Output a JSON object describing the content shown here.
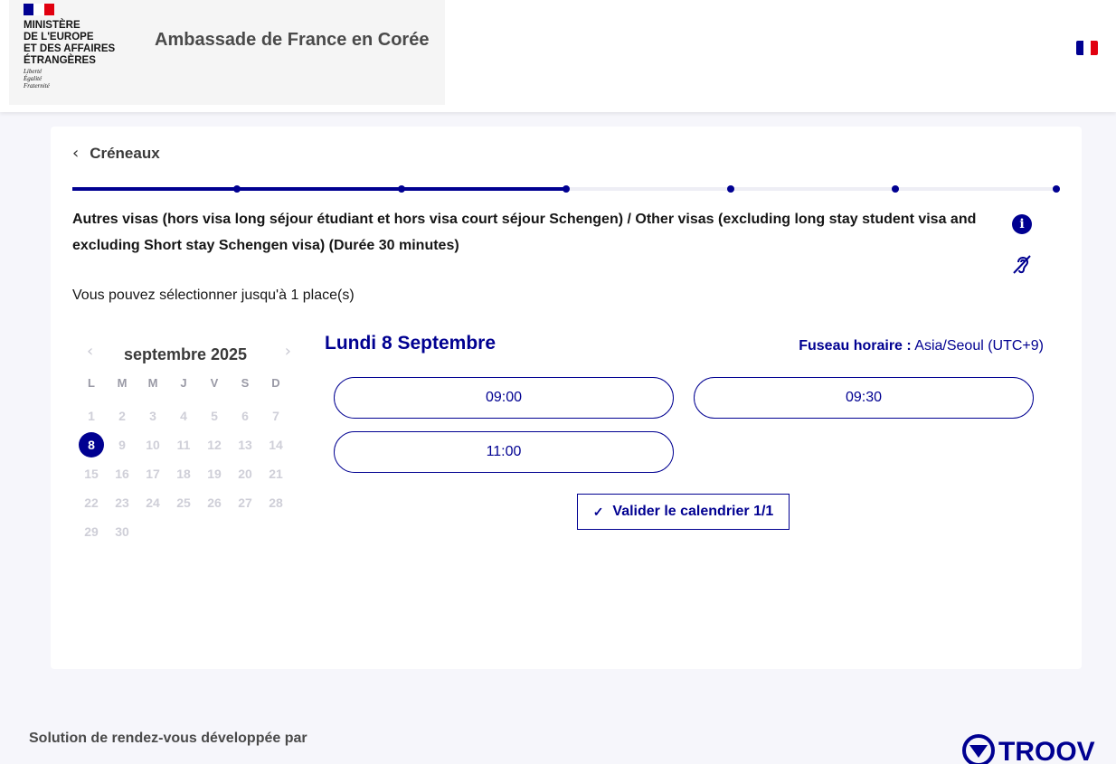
{
  "header": {
    "ministry_lines": [
      "MINISTÈRE",
      "DE L'EUROPE",
      "ET DES AFFAIRES",
      "ÉTRANGÈRES"
    ],
    "motto_lines": [
      "Liberté",
      "Égalité",
      "Fraternité"
    ],
    "embassy_name": "Ambassade de France en Corée",
    "flag_colors": [
      "#000091",
      "#ffffff",
      "#e1000f"
    ]
  },
  "booking": {
    "back_label": "Créneaux",
    "stepper": {
      "total_steps": 7,
      "completed_steps": 4
    },
    "service_title": "Autres visas (hors visa long séjour étudiant et hors visa court séjour Schengen) / Other visas (excluding long stay student visa and excluding Short stay Schengen visa) (Durée 30 minutes)",
    "info_icon": "info-icon",
    "accessibility_icon": "hearing-impaired-icon",
    "max_places": "Vous pouvez sélectionner jusqu'à 1 place(s)"
  },
  "calendar": {
    "month_label": "septembre 2025",
    "weekdays": [
      "L",
      "M",
      "M",
      "J",
      "V",
      "S",
      "D"
    ],
    "days": [
      "1",
      "2",
      "3",
      "4",
      "5",
      "6",
      "7",
      "8",
      "9",
      "10",
      "11",
      "12",
      "13",
      "14",
      "15",
      "16",
      "17",
      "18",
      "19",
      "20",
      "21",
      "22",
      "23",
      "24",
      "25",
      "26",
      "27",
      "28",
      "29",
      "30"
    ],
    "selected_day": "8"
  },
  "slots_panel": {
    "day_title": "Lundi 8 Septembre",
    "timezone_label": "Fuseau horaire :",
    "timezone_value": "Asia/Seoul (UTC+9)",
    "slots": [
      "09:00",
      "09:30",
      "11:00"
    ],
    "validate_label": "Valider le calendrier 1/1"
  },
  "footer": {
    "powered_by": "Solution de rendez-vous développée par",
    "brand": "TROOV"
  },
  "colors": {
    "accent": "#000091",
    "page_background": "#f6f6fb",
    "disabled_day": "#cfcfd8"
  }
}
